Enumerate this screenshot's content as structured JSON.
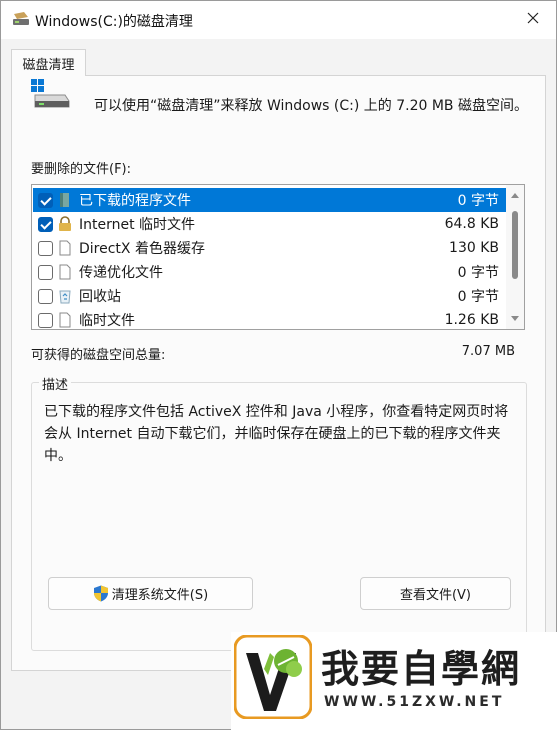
{
  "window": {
    "title": "Windows(C:)的磁盘清理",
    "close_icon": "close-icon"
  },
  "tab": {
    "label": "磁盘清理"
  },
  "intro": {
    "text": "可以使用“磁盘清理”来释放 Windows (C:) 上的 7.20 MB 磁盘空间。"
  },
  "files": {
    "label": "要删除的文件(F):",
    "items": [
      {
        "name": "已下载的程序文件",
        "size": "0 字节",
        "checked": true,
        "selected": true,
        "icon": "folder-icon"
      },
      {
        "name": "Internet 临时文件",
        "size": "64.8 KB",
        "checked": true,
        "selected": false,
        "icon": "lock-icon"
      },
      {
        "name": "DirectX 着色器缓存",
        "size": "130 KB",
        "checked": false,
        "selected": false,
        "icon": "file-icon"
      },
      {
        "name": "传递优化文件",
        "size": "0 字节",
        "checked": false,
        "selected": false,
        "icon": "file-icon"
      },
      {
        "name": "回收站",
        "size": "0 字节",
        "checked": false,
        "selected": false,
        "icon": "recycle-bin-icon"
      },
      {
        "name": "临时文件",
        "size": "1.26 KB",
        "checked": false,
        "selected": false,
        "icon": "file-icon"
      }
    ]
  },
  "space": {
    "label": "可获得的磁盘空间总量:",
    "value": "7.07 MB"
  },
  "description": {
    "title": "描述",
    "text": "已下载的程序文件包括 ActiveX 控件和 Java 小程序，你查看特定网页时将会从 Internet 自动下载它们，并临时保存在硬盘上的已下载的程序文件夹中。"
  },
  "buttons": {
    "clean_system": "清理系统文件(S)",
    "view_files": "查看文件(V)"
  },
  "watermark": {
    "title": "我要自學網",
    "url": "WWW.51ZXW.NET"
  },
  "colors": {
    "selection": "#0078d7",
    "checkbox": "#005fb8",
    "window_bg": "#f3f3f3"
  }
}
